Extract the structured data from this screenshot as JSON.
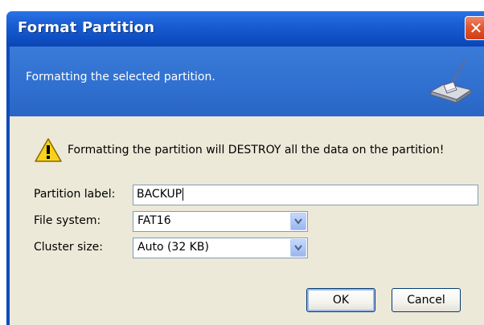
{
  "window": {
    "title": "Format Partition",
    "close_label": "✕"
  },
  "header": {
    "text": "Formatting the selected partition.",
    "icon": "format-disk-icon"
  },
  "warning": {
    "icon": "warning-icon",
    "text": "Formatting the partition will DESTROY all the data on the partition!"
  },
  "form": {
    "partition_label": {
      "label": "Partition label:",
      "value": "BACKUP"
    },
    "file_system": {
      "label": "File system:",
      "value": "FAT16"
    },
    "cluster_size": {
      "label": "Cluster size:",
      "value": "Auto (32 KB)"
    }
  },
  "buttons": {
    "ok": "OK",
    "cancel": "Cancel"
  },
  "colors": {
    "titlebar": "#0f4fc5",
    "header": "#2f6fcf",
    "dialog_bg": "#ece9d8",
    "close": "#e3582f"
  }
}
